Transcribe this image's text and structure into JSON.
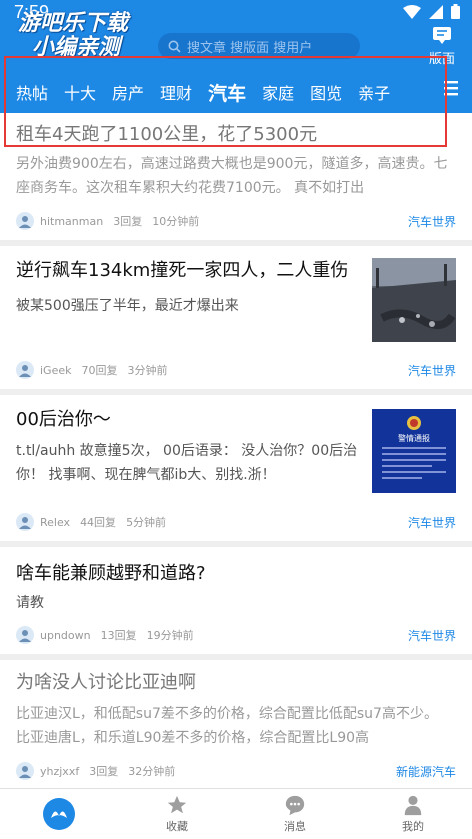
{
  "status": {
    "time": "7:59"
  },
  "brand": {
    "line1": "游吧乐下载",
    "line2": "小编亲测"
  },
  "search": {
    "placeholder": "搜文章 搜版面 搜用户"
  },
  "header": {
    "banmian_label": "版面"
  },
  "tabs": [
    {
      "label": "热帖"
    },
    {
      "label": "十大"
    },
    {
      "label": "房产"
    },
    {
      "label": "理财"
    },
    {
      "label": "汽车",
      "active": true
    },
    {
      "label": "家庭"
    },
    {
      "label": "图览"
    },
    {
      "label": "亲子"
    }
  ],
  "posts": [
    {
      "title": "租车4天跑了1100公里，花了5300元",
      "snippet": "另外油费900左右，高速过路费大概也是900元，隧道多，高速贵。七座商务车。这次租车累积大约花费7100元。 真不如打出",
      "author": "hitmanman",
      "replies": "3回复",
      "time": "10分钟前",
      "forum": "汽车世界"
    },
    {
      "title": "逆行飙车134km撞死一家四人，二人重伤",
      "snippet": "被某500强压了半年，最近才爆出来",
      "author": "iGeek",
      "replies": "70回复",
      "time": "3分钟前",
      "forum": "汽车世界"
    },
    {
      "title": "00后治你～",
      "snippet": "t.tl/auhh 故意撞5次， 00后语录： 没人治你？00后治你！ 找事啊、现在脾气都ib大、别找.浙！",
      "author": "Relex",
      "replies": "44回复",
      "time": "5分钟前",
      "forum": "汽车世界",
      "thumb_text": "警情通报"
    },
    {
      "title": "啥车能兼顾越野和道路?",
      "snippet": "请教",
      "author": "upndown",
      "replies": "13回复",
      "time": "19分钟前",
      "forum": "汽车世界"
    },
    {
      "title": "为啥没人讨论比亚迪啊",
      "snippet": "比亚迪汉L，和低配su7差不多的价格，综合配置比低配su7高不少。 比亚迪唐L，和乐道L90差不多的价格，综合配置比L90高",
      "author": "yhzjxxf",
      "replies": "3回复",
      "time": "32分钟前",
      "forum": "新能源汽车"
    }
  ],
  "bottom_nav": [
    {
      "label": "",
      "icon": "home-logo-icon"
    },
    {
      "label": "收藏",
      "icon": "star-icon"
    },
    {
      "label": "消息",
      "icon": "chat-bubble-icon"
    },
    {
      "label": "我的",
      "icon": "person-icon"
    }
  ],
  "colors": {
    "primary": "#1e88e5",
    "highlight": "#e53935"
  }
}
